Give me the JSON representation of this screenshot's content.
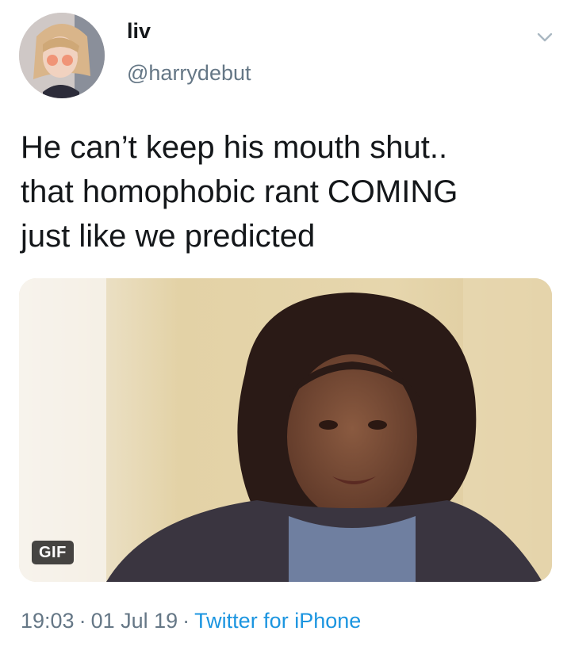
{
  "user": {
    "display_name": "liv",
    "handle": "@harrydebut"
  },
  "tweet": {
    "text": "He can’t keep his mouth shut..\nthat homophobic rant COMING\njust like we predicted"
  },
  "media": {
    "badge": "GIF"
  },
  "meta": {
    "time": "19:03",
    "date": "01 Jul 19",
    "separator": "·",
    "source": "Twitter for iPhone"
  },
  "icons": {
    "menu": "chevron-down-icon"
  },
  "colors": {
    "text_primary": "#14171a",
    "text_secondary": "#657786",
    "link": "#1b95e0",
    "badge_background": "#000000"
  }
}
